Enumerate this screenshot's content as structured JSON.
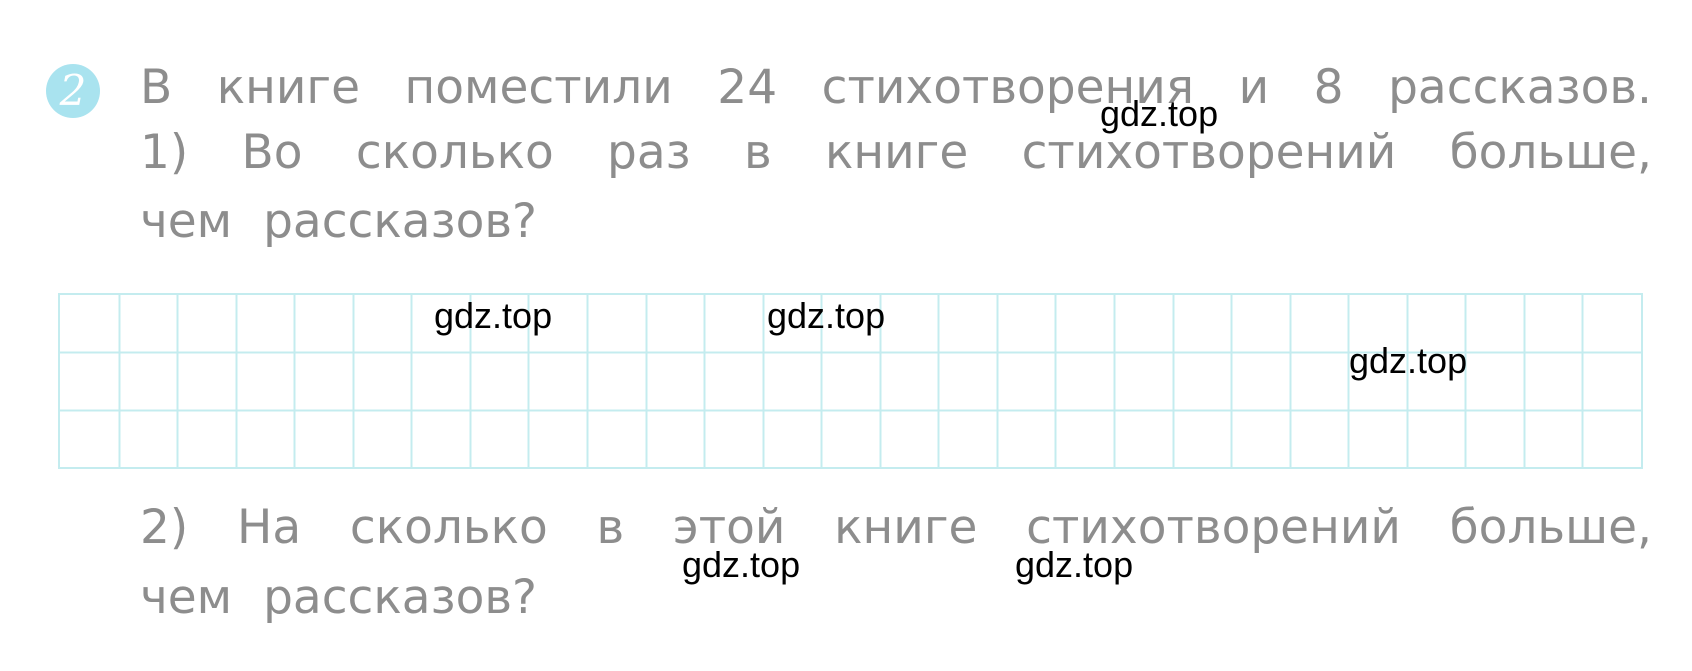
{
  "task": {
    "number": "2",
    "statement": "В книге поместили 24 стихотворения и 8 рассказов.",
    "question1": {
      "line1": "1) Во сколько раз в книге стихотворений больше,",
      "line2": "чем рассказов?"
    },
    "question2": {
      "line1": "2) На сколько в этой книге стихотворений больше,",
      "line2": "чем рассказов?"
    }
  },
  "answer_grid": {
    "columns": 27,
    "rows": 3,
    "line_color": "#c4ecef"
  },
  "colors": {
    "text": "#8d8d8d",
    "badge": "#a9e3ef",
    "watermark": "#000000"
  },
  "watermarks": [
    "gdz.top",
    "gdz.top",
    "gdz.top",
    "gdz.top",
    "gdz.top",
    "gdz.top"
  ]
}
